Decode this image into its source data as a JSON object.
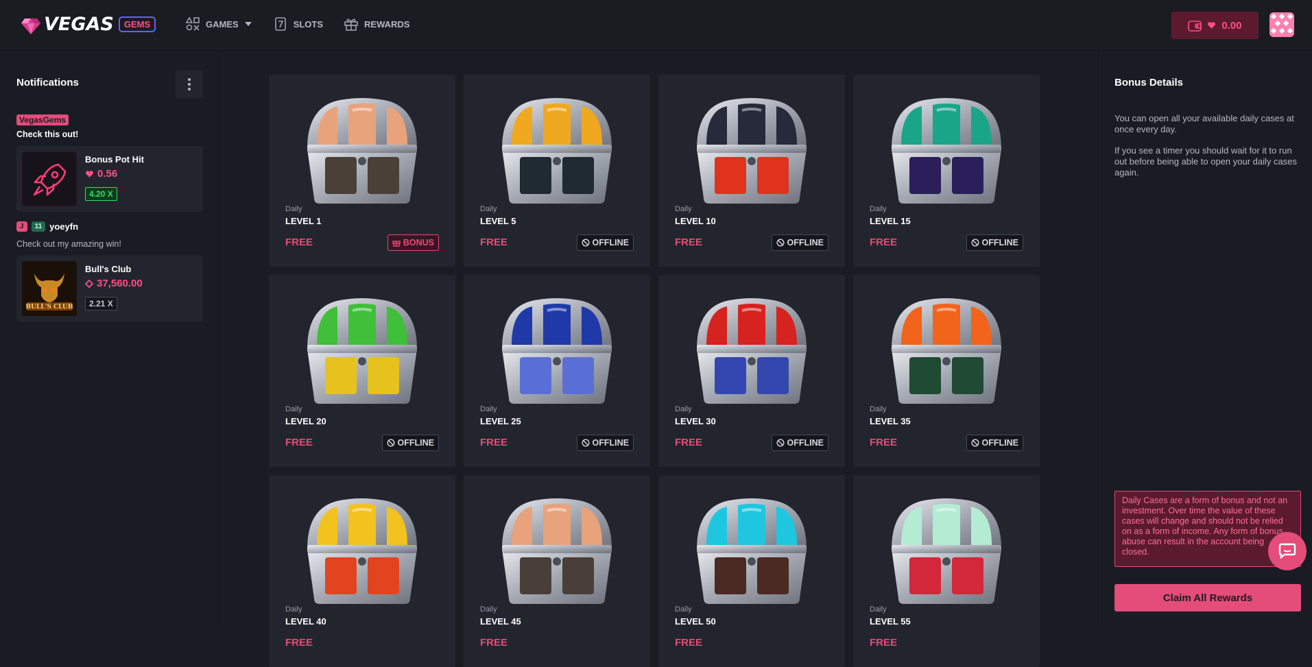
{
  "header": {
    "logo_text": "VEGAS",
    "logo_badge": "GEMS",
    "nav": [
      {
        "label": "GAMES",
        "icon": "games-icon"
      },
      {
        "label": "SLOTS",
        "icon": "slots-icon"
      },
      {
        "label": "REWARDS",
        "icon": "gift-icon"
      }
    ],
    "balance": "0.00"
  },
  "notifications": {
    "title": "Notifications",
    "tag": "VegasGems",
    "msg1": "Check this out!",
    "item1": {
      "name": "Bonus Pot Hit",
      "amount": "0.56",
      "multiplier": "4.20 X"
    },
    "user": {
      "level_initial": "J",
      "level_num": "11",
      "name": "yoeyfn"
    },
    "msg2": "Check out my amazing win!",
    "item2": {
      "name": "Bull's Club",
      "thumb_text": "BULL'S CLUB",
      "amount": "37,560.00",
      "multiplier": "2.21 X"
    }
  },
  "cases": [
    {
      "daily": "Daily",
      "level": "LEVEL 1",
      "price": "FREE",
      "status": "BONUS",
      "lid": "#e9a37c",
      "base": "#4a4038"
    },
    {
      "daily": "Daily",
      "level": "LEVEL 5",
      "price": "FREE",
      "status": "OFFLINE",
      "lid": "#f0a820",
      "base": "#1f2a33"
    },
    {
      "daily": "Daily",
      "level": "LEVEL 10",
      "price": "FREE",
      "status": "OFFLINE",
      "lid": "#262a3a",
      "base": "#e0331c"
    },
    {
      "daily": "Daily",
      "level": "LEVEL 15",
      "price": "FREE",
      "status": "OFFLINE",
      "lid": "#1aa588",
      "base": "#2a1f5a"
    },
    {
      "daily": "Daily",
      "level": "LEVEL 20",
      "price": "FREE",
      "status": "OFFLINE",
      "lid": "#3fbf3a",
      "base": "#e6c21f"
    },
    {
      "daily": "Daily",
      "level": "LEVEL 25",
      "price": "FREE",
      "status": "OFFLINE",
      "lid": "#1f3aa8",
      "base": "#5a6fd6"
    },
    {
      "daily": "Daily",
      "level": "LEVEL 30",
      "price": "FREE",
      "status": "OFFLINE",
      "lid": "#d6231f",
      "base": "#3447b0"
    },
    {
      "daily": "Daily",
      "level": "LEVEL 35",
      "price": "FREE",
      "status": "OFFLINE",
      "lid": "#f2631c",
      "base": "#1f4a33"
    },
    {
      "daily": "Daily",
      "level": "LEVEL 40",
      "price": "FREE",
      "status": "",
      "lid": "#f2c21f",
      "base": "#e2441f"
    },
    {
      "daily": "Daily",
      "level": "LEVEL 45",
      "price": "FREE",
      "status": "",
      "lid": "#e8a27c",
      "base": "#4a3f38"
    },
    {
      "daily": "Daily",
      "level": "LEVEL 50",
      "price": "FREE",
      "status": "",
      "lid": "#1fc6e0",
      "base": "#4a2a22"
    },
    {
      "daily": "Daily",
      "level": "LEVEL 55",
      "price": "FREE",
      "status": "",
      "lid": "#b3ecd3",
      "base": "#d2283a"
    }
  ],
  "bonus_details": {
    "title": "Bonus Details",
    "p1": "You can open all your available daily cases at once every day.",
    "p2": "If you see a timer you should wait for it to run out before being able to open your daily cases again.",
    "warning": "Daily Cases are a form of bonus and not an investment. Over time the value of these cases will change and should not be relied on as a form of income. Any form of bonus abuse can result in the account being closed.",
    "claim_label": "Claim All Rewards"
  },
  "colors": {
    "accent": "#e44c79",
    "bg": "#1a1c23",
    "card": "#23252e"
  }
}
